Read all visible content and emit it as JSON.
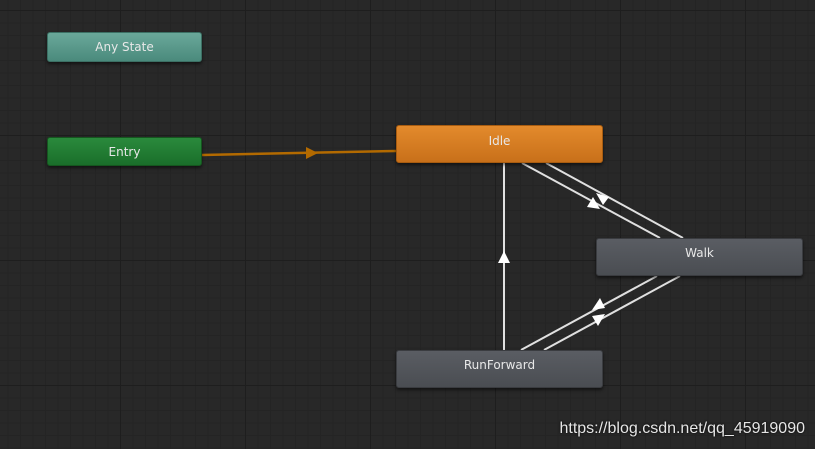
{
  "states": {
    "any_state": "Any State",
    "entry": "Entry",
    "idle": "Idle",
    "walk": "Walk",
    "run_forward": "RunForward"
  },
  "colors": {
    "canvas_bg": "#282828",
    "any_state": "#5a9a8c",
    "entry": "#21803a",
    "idle": "#d77c22",
    "walk": "#525559",
    "run_forward": "#525559",
    "default_transition": "#b36a00",
    "transition": "#e0e0e0"
  },
  "transitions": [
    {
      "from": "Entry",
      "to": "Idle",
      "default": true
    },
    {
      "from": "Idle",
      "to": "Walk"
    },
    {
      "from": "Walk",
      "to": "Idle"
    },
    {
      "from": "RunForward",
      "to": "Idle"
    },
    {
      "from": "Walk",
      "to": "RunForward"
    },
    {
      "from": "RunForward",
      "to": "Walk"
    }
  ],
  "watermark": "https://blog.csdn.net/qq_45919090"
}
